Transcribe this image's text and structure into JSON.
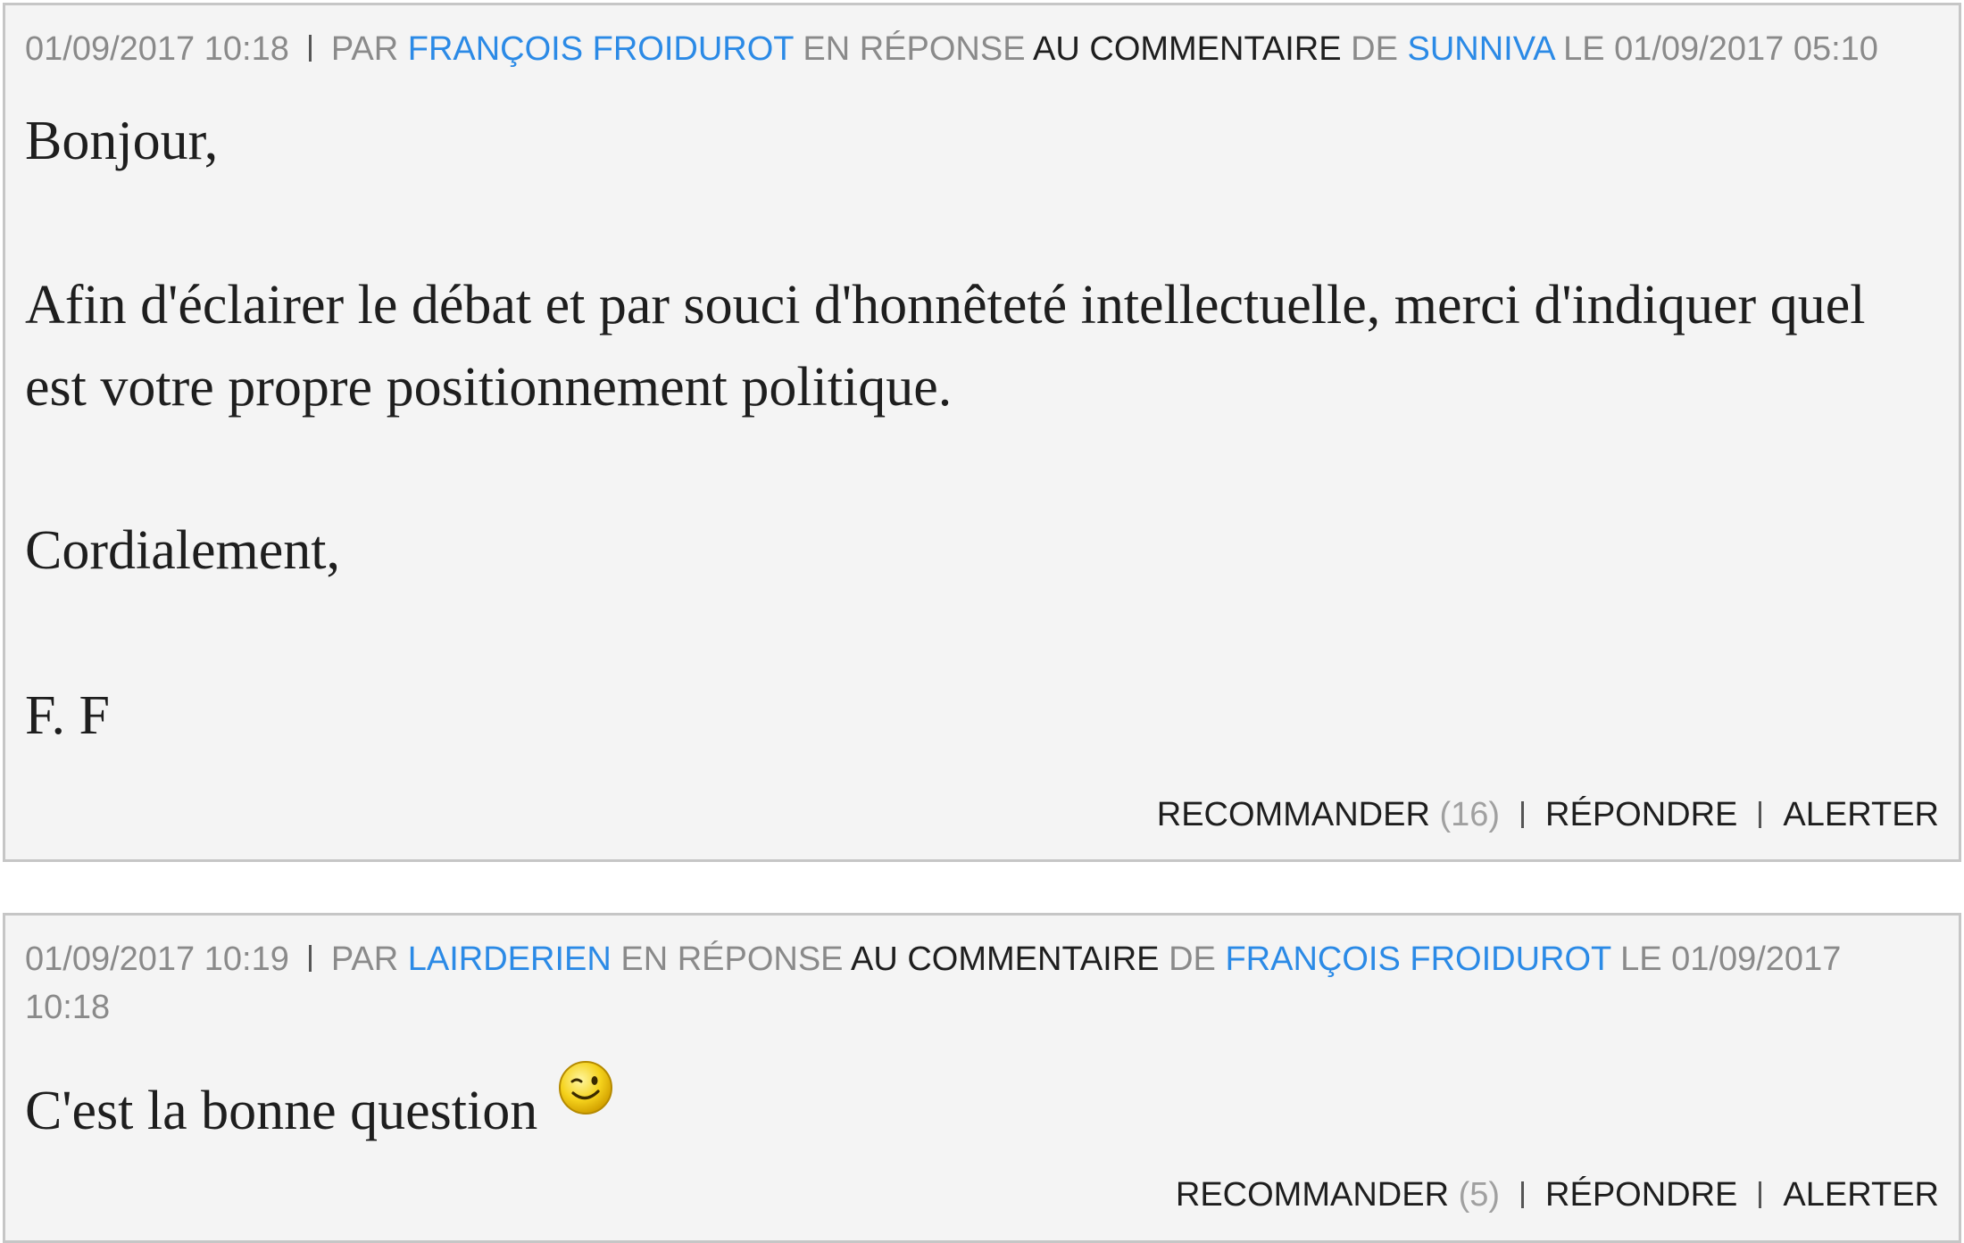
{
  "comments": [
    {
      "timestamp": "01/09/2017 10:18",
      "by_label": "PAR",
      "author": "FRANÇOIS FROIDUROT",
      "in_reply_label": "EN RÉPONSE",
      "comment_link": "AU COMMENTAIRE",
      "of_label": "DE",
      "target_author": "SUNNIVA",
      "target_date_label": "LE 01/09/2017 05:10",
      "paragraphs": [
        "Bonjour,",
        "Afin d'éclairer le débat et par souci d'honnêteté intellectuelle, merci d'indiquer quel est votre propre positionnement politique.",
        "Cordialement,",
        "F. F"
      ],
      "recommend_label": "RECOMMANDER",
      "recommend_count": "(16)",
      "reply_label": "RÉPONDRE",
      "alert_label": "ALERTER"
    },
    {
      "timestamp": "01/09/2017 10:19",
      "by_label": "PAR",
      "author": "LAIRDERIEN",
      "in_reply_label": "EN RÉPONSE",
      "comment_link": "AU COMMENTAIRE",
      "of_label": "DE",
      "target_author": "FRANÇOIS FROIDUROT",
      "target_date_label": "LE 01/09/2017 10:18",
      "paragraphs": [
        "C'est la bonne question"
      ],
      "emoticon": "wink-smiley-icon",
      "recommend_label": "RECOMMANDER",
      "recommend_count": "(5)",
      "reply_label": "RÉPONDRE",
      "alert_label": "ALERTER"
    }
  ],
  "colors": {
    "link_blue": "#2b8ae6",
    "meta_gray": "#8a8a8a",
    "panel_bg": "#f4f4f4",
    "border": "#c6c6c6",
    "text": "#1e1e1e"
  }
}
